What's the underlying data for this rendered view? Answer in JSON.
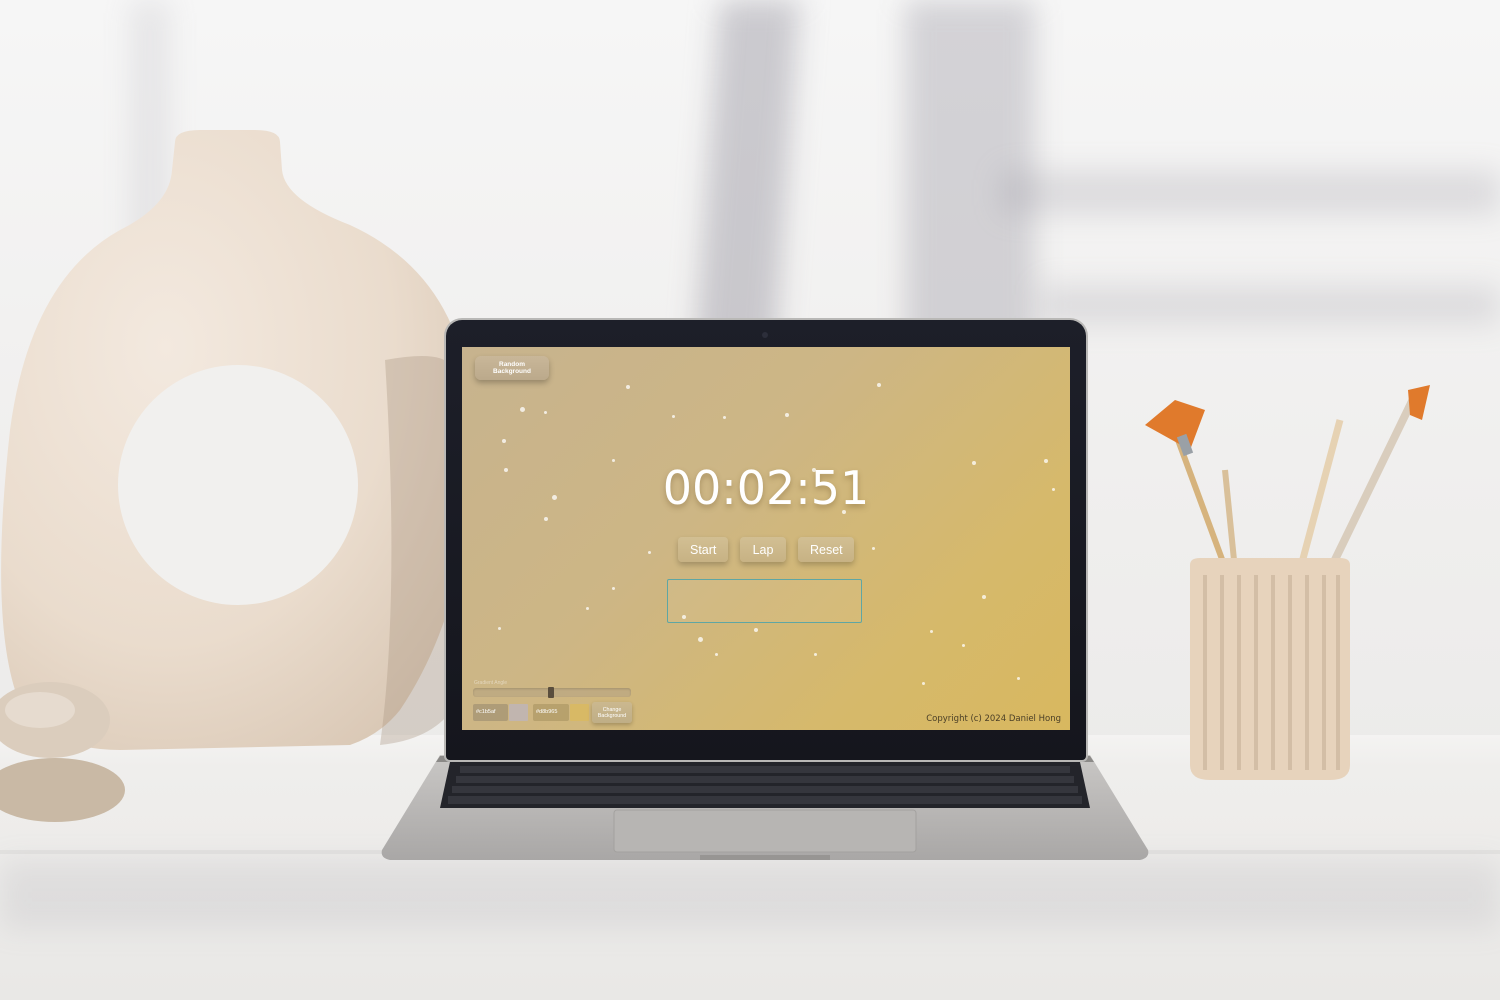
{
  "app": {
    "random_bg_label": "Random Background",
    "timer": "00:02:51",
    "buttons": {
      "start": "Start",
      "lap": "Lap",
      "reset": "Reset"
    },
    "lap_list": [],
    "gradient_panel": {
      "slider_label": "Gradient Angle",
      "color_a_hex": "#c1b5af",
      "color_a": "#c1b5af",
      "color_b_hex": "#d8b965",
      "color_b": "#d8b965",
      "change_label": "Change Background"
    },
    "copyright": "Copyright (c) 2024 Daniel Hong"
  },
  "colors": {
    "background_from": "#c7b38e",
    "background_to": "#d8b85f",
    "lap_border": "#5fa6a3",
    "text": "#ffffff"
  }
}
